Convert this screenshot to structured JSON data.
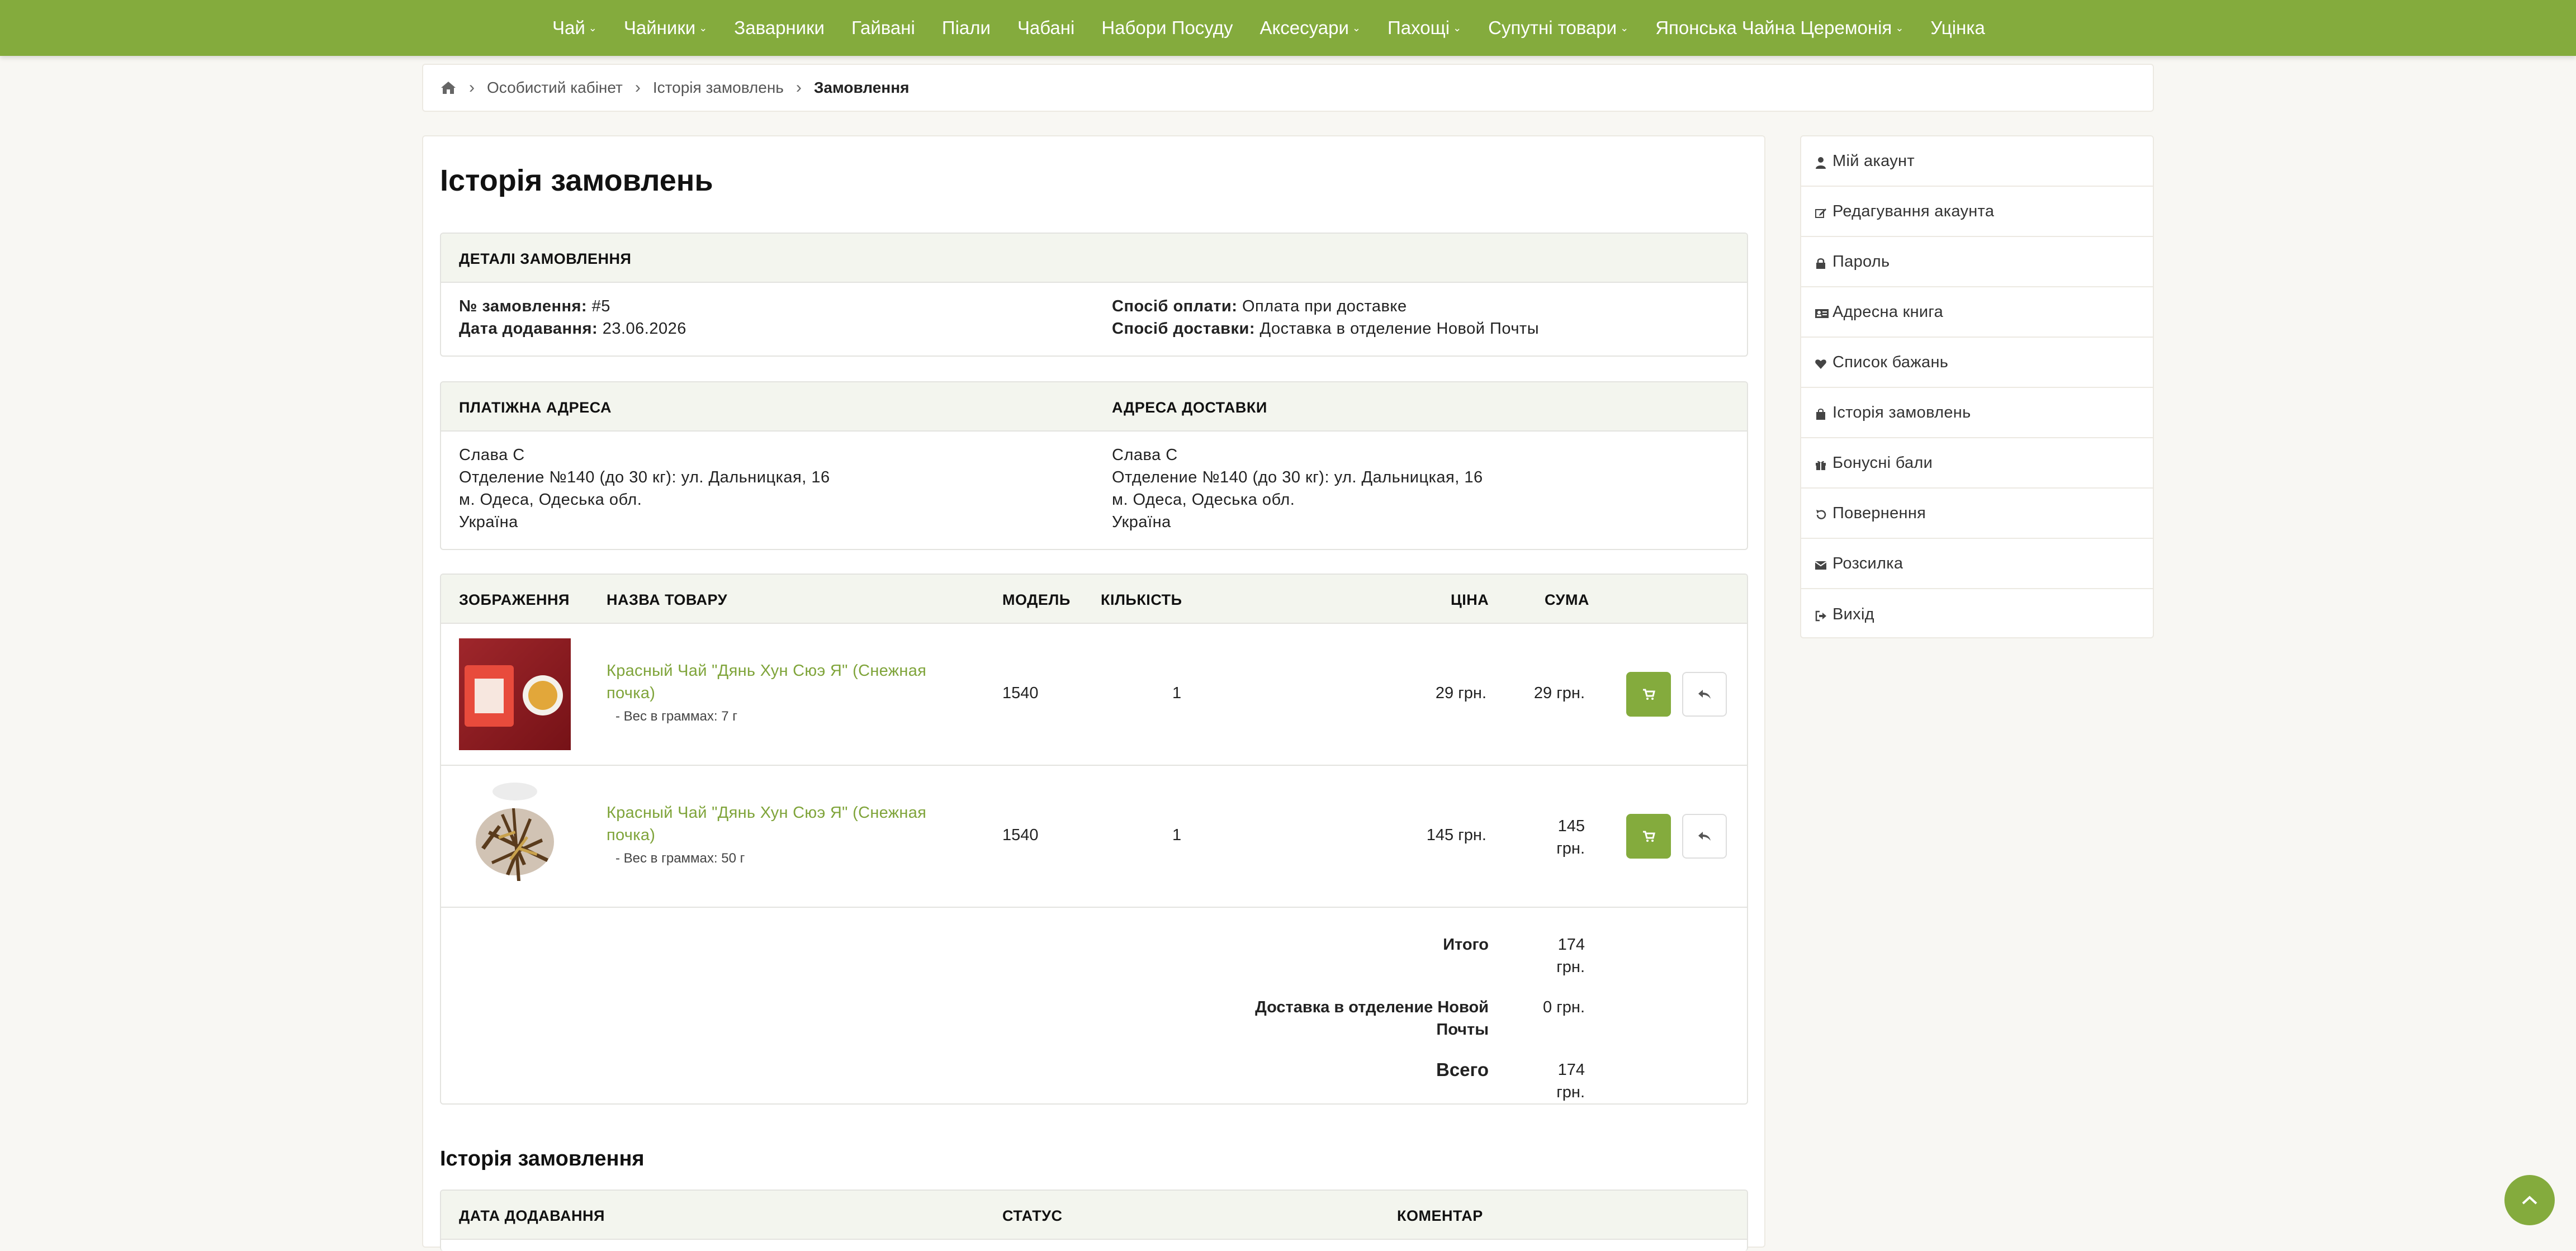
{
  "nav": {
    "items": [
      {
        "label": "Чай",
        "dropdown": true
      },
      {
        "label": "Чайники",
        "dropdown": true
      },
      {
        "label": "Заварники",
        "dropdown": false
      },
      {
        "label": "Гайвані",
        "dropdown": false
      },
      {
        "label": "Піали",
        "dropdown": false
      },
      {
        "label": "Чабані",
        "dropdown": false
      },
      {
        "label": "Набори Посуду",
        "dropdown": false
      },
      {
        "label": "Аксесуари",
        "dropdown": true
      },
      {
        "label": "Пахощі",
        "dropdown": true
      },
      {
        "label": "Супутні товари",
        "dropdown": true
      },
      {
        "label": "Японська Чайна Церемонія",
        "dropdown": true
      },
      {
        "label": "Уцінка",
        "dropdown": false
      }
    ],
    "caret_glyph": "⌄"
  },
  "breadcrumb": {
    "home_icon": "home-icon",
    "separator": "›",
    "items": [
      "Особистий кабінет",
      "Історія замовлень",
      "Замовлення"
    ]
  },
  "page": {
    "title": "Історія замовлень"
  },
  "order_details": {
    "heading": "ДЕТАЛІ ЗАМОВЛЕННЯ",
    "order_no_label": "№ замовлення:",
    "order_no": "#5",
    "date_label": "Дата додавання:",
    "date": "23.06.2026",
    "payment_label": "Спосіб оплати:",
    "payment": "Оплата при доставке",
    "shipping_label": "Спосіб доставки:",
    "shipping": "Доставка в отделение Новой Почты"
  },
  "addresses": {
    "payment_heading": "ПЛАТІЖНА АДРЕСА",
    "shipping_heading": "АДРЕСА ДОСТАВКИ",
    "payment_lines": [
      "Слава С",
      "Отделение №140 (до 30 кг): ул. Дальницкая, 16",
      "м. Одеса, Одеська обл.",
      "Україна"
    ],
    "shipping_lines": [
      "Слава С",
      "Отделение №140 (до 30 кг): ул. Дальницкая, 16",
      "м. Одеса, Одеська обл.",
      "Україна"
    ]
  },
  "products": {
    "headers": {
      "image": "ЗОБРАЖЕННЯ",
      "name": "НАЗВА ТОВАРУ",
      "model": "МОДЕЛЬ",
      "qty": "КІЛЬКІСТЬ",
      "price": "ЦІНА",
      "total": "СУМА"
    },
    "rows": [
      {
        "name": "Красный Чай \"Дянь Хун Сюэ Я\" (Снежная почка)",
        "option": "- Вес в граммах: 7 г",
        "model": "1540",
        "qty": "1",
        "price": "29 грн.",
        "total": "29 грн."
      },
      {
        "name": "Красный Чай \"Дянь Хун Сюэ Я\" (Снежная почка)",
        "option": "- Вес в граммах: 50 г",
        "model": "1540",
        "qty": "1",
        "price": "145 грн.",
        "total_line1": "145",
        "total_line2": "грн."
      }
    ],
    "totals": [
      {
        "label_line1": "Итого",
        "label_line2": "",
        "value_line1": "174",
        "value_line2": "грн."
      },
      {
        "label_line1": "Доставка в отделение Новой",
        "label_line2": "Почты",
        "value_line1": "0 грн.",
        "value_line2": ""
      },
      {
        "label_line1": "Всего",
        "label_line2": "",
        "value_line1": "174",
        "value_line2": "грн."
      }
    ]
  },
  "history": {
    "title": "Історія замовлення",
    "headers": {
      "date": "ДАТА ДОДАВАННЯ",
      "status": "СТАТУС",
      "comment": "КОМЕНТАР"
    }
  },
  "sidebar": {
    "items": [
      {
        "label": "Мій акаунт",
        "icon": "user-icon"
      },
      {
        "label": "Редагування акаунта",
        "icon": "edit-icon"
      },
      {
        "label": "Пароль",
        "icon": "lock-icon"
      },
      {
        "label": "Адресна книга",
        "icon": "address-card-icon"
      },
      {
        "label": "Список бажань",
        "icon": "heart-icon"
      },
      {
        "label": "Історія замовлень",
        "icon": "shopping-bag-icon"
      },
      {
        "label": "Бонусні бали",
        "icon": "gift-icon"
      },
      {
        "label": "Повернення",
        "icon": "undo-icon"
      },
      {
        "label": "Розсилка",
        "icon": "envelope-icon"
      },
      {
        "label": "Вихід",
        "icon": "sign-out-icon"
      }
    ]
  },
  "colors": {
    "accent": "#84ab3d",
    "link": "#7fa43a",
    "panel_head": "#f3f5ee",
    "background": "#f8f7f3"
  }
}
